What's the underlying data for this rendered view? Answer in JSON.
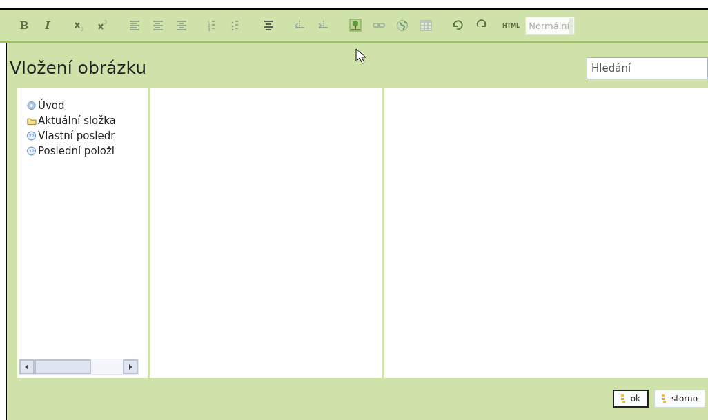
{
  "toolbar": {
    "buttons": [
      {
        "kind": "bold",
        "label": "B"
      },
      {
        "kind": "italic",
        "label": "I"
      },
      {
        "kind": "gap"
      },
      {
        "kind": "subscript"
      },
      {
        "kind": "superscript"
      },
      {
        "kind": "gap"
      },
      {
        "kind": "align-left"
      },
      {
        "kind": "align-center"
      },
      {
        "kind": "align-right"
      },
      {
        "kind": "gap"
      },
      {
        "kind": "ordered-list"
      },
      {
        "kind": "unordered-list"
      },
      {
        "kind": "gap"
      },
      {
        "kind": "center-lines"
      },
      {
        "kind": "gap"
      },
      {
        "kind": "outdent"
      },
      {
        "kind": "indent"
      },
      {
        "kind": "gap"
      },
      {
        "kind": "image"
      },
      {
        "kind": "link"
      },
      {
        "kind": "globe"
      },
      {
        "kind": "table"
      },
      {
        "kind": "gap"
      },
      {
        "kind": "undo"
      },
      {
        "kind": "redo"
      }
    ],
    "html_label": "HTML",
    "format_select": {
      "value": "Normální",
      "disabled": true
    }
  },
  "dialog": {
    "title": "Vložení obrázku",
    "search": {
      "placeholder": "Hledání"
    },
    "tree": [
      {
        "kind": "home",
        "label": "Úvod"
      },
      {
        "kind": "folder",
        "label": "Aktuální složka"
      },
      {
        "kind": "recent",
        "label": "Vlastní posledr"
      },
      {
        "kind": "recent",
        "label": "Poslední položl"
      }
    ],
    "buttons": [
      {
        "label": "ok",
        "focused": true
      },
      {
        "label": "storno",
        "focused": false
      }
    ]
  }
}
